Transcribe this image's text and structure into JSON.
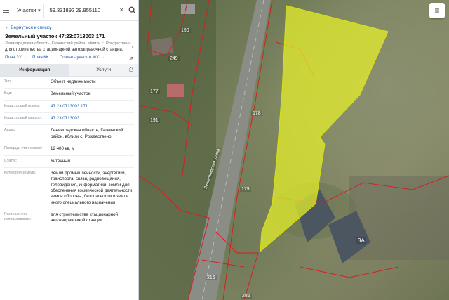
{
  "search": {
    "category": "Участки",
    "value": "59.331892 29.955110"
  },
  "back_link": "← Вернуться к списку",
  "parcel": {
    "title": "Земельный участок 47:23:0713003:171",
    "address_short": "Ленинградская область, Гатчинский район, вблизи с. Рождествено",
    "use": "для строительства стационарной автозаправочной станции."
  },
  "links": {
    "plan_zu": "План ЗУ →",
    "plan_kk": "План КК →",
    "create_zu": "Создать участок ЖС →"
  },
  "tabs": [
    "Информация",
    "Услуги"
  ],
  "properties": [
    {
      "key": "Тип:",
      "value": "Объект недвижимости"
    },
    {
      "key": "Вид:",
      "value": "Земельный участок"
    },
    {
      "key": "Кадастровый номер:",
      "value": "47:23:0713003:171"
    },
    {
      "key": "Кадастровый квартал:",
      "value": "47:23:0713003"
    },
    {
      "key": "Адрес:",
      "value": "Ленинградская область, Гатчинский район, вблизи с. Рождествено"
    },
    {
      "key": "Площадь уточненная:",
      "value": "12 400 кв. м"
    },
    {
      "key": "Статус:",
      "value": "Учтенный"
    },
    {
      "key": "Категория земель:",
      "value": "Земли промышленности, энергетики, транспорта, связи, радиовещания, телевидения, информатики, земли для обеспечения космической деятельности, земли обороны, безопасности и земли иного специального назначения"
    },
    {
      "key": "Разрешенное использование:",
      "value": "для строительства стационарной автозаправочной станции."
    }
  ],
  "map": {
    "parcel_labels": [
      "190",
      "249",
      "177",
      "191",
      "179",
      "3А",
      "216",
      "286",
      "178"
    ],
    "road_label": "Ленинградская улица",
    "highlight_color": "#e8f22a",
    "boundary_color": "#d42020"
  }
}
